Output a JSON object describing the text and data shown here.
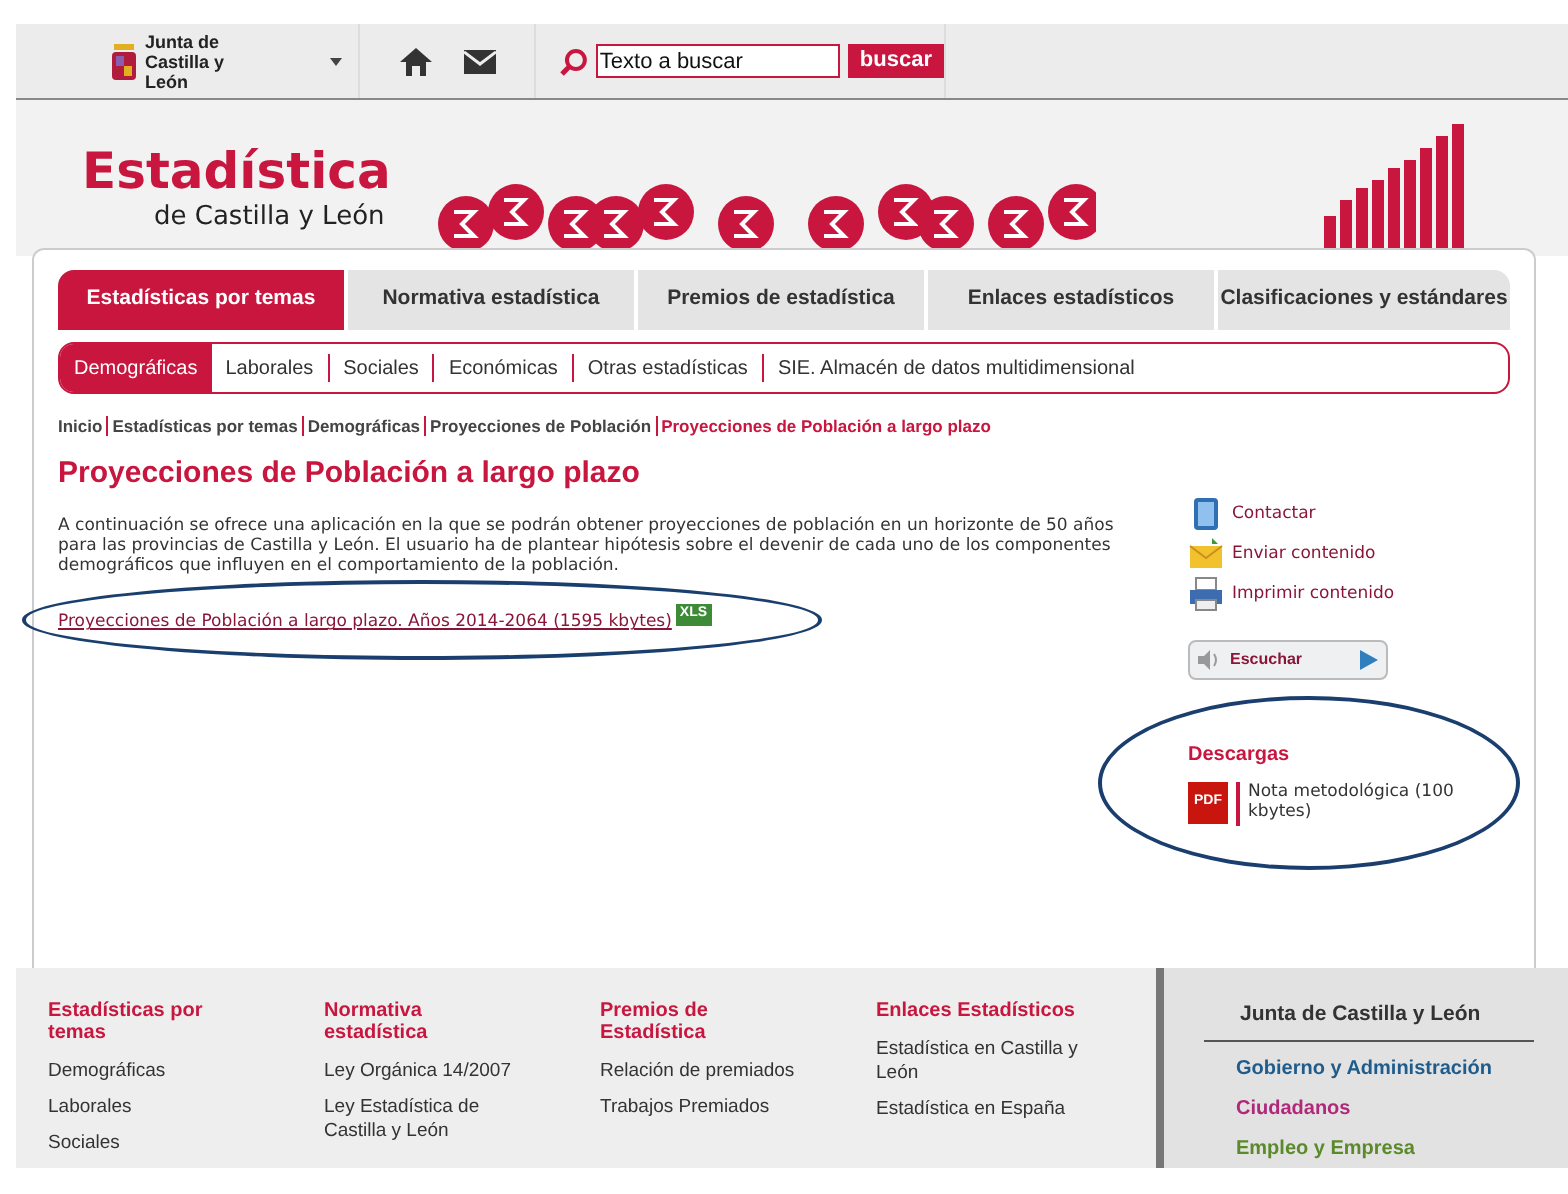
{
  "header": {
    "logo_text": "Junta de Castilla y León",
    "search": {
      "placeholder": "Texto a buscar"
    },
    "search_button": "buscar"
  },
  "banner": {
    "title": "Estadística",
    "subtitle": "de Castilla y León"
  },
  "tabs": [
    {
      "label": "Estadísticas por temas",
      "selected": true
    },
    {
      "label": "Normativa estadística",
      "selected": false
    },
    {
      "label": "Premios de estadística",
      "selected": false
    },
    {
      "label": "Enlaces estadísticos",
      "selected": false
    },
    {
      "label": "Clasificaciones y estándares",
      "selected": false
    }
  ],
  "subtabs": [
    {
      "label": "Demográficas",
      "selected": true
    },
    {
      "label": "Laborales",
      "selected": false
    },
    {
      "label": "Sociales",
      "selected": false
    },
    {
      "label": "Económicas",
      "selected": false
    },
    {
      "label": "Otras estadísticas",
      "selected": false
    },
    {
      "label": "SIE. Almacén de datos multidimensional",
      "selected": false
    }
  ],
  "breadcrumb": [
    {
      "label": "Inicio",
      "current": false
    },
    {
      "label": "Estadísticas por temas",
      "current": false
    },
    {
      "label": "Demográficas",
      "current": false
    },
    {
      "label": "Proyecciones de Población",
      "current": false
    },
    {
      "label": "Proyecciones de Población a largo plazo",
      "current": true
    }
  ],
  "page_title": "Proyecciones de Población a largo plazo",
  "intro": "A continuación se ofrece una aplicación en la que se podrán obtener proyecciones de población en un horizonte de 50 años para las provincias de Castilla y León. El usuario ha de plantear hipótesis sobre el devenir de cada uno de los componentes demográficos que influyen en el comportamiento de la población.",
  "download_link": {
    "label": "Proyecciones de Población a largo plazo. Años 2014-2064 (1595 kbytes)",
    "badge": "XLS"
  },
  "actions": [
    {
      "kind": "contact",
      "label": "Contactar"
    },
    {
      "kind": "send",
      "label": "Enviar contenido"
    },
    {
      "kind": "print",
      "label": "Imprimir contenido"
    }
  ],
  "listen_button": "Escuchar",
  "downloads": {
    "title": "Descargas",
    "items": [
      {
        "badge": "PDF",
        "label": "Nota metodológica (100 kbytes)"
      }
    ]
  },
  "footer": {
    "columns": [
      {
        "title": "Estadísticas por temas",
        "links": [
          "Demográficas",
          "Laborales",
          "Sociales"
        ]
      },
      {
        "title": "Normativa estadística",
        "links": [
          "Ley Orgánica 14/2007",
          "Ley Estadística de Castilla y León"
        ]
      },
      {
        "title": "Premios de Estadística",
        "links": [
          "Relación de premiados",
          "Trabajos Premiados"
        ]
      },
      {
        "title": "Enlaces Estadísticos",
        "links": [
          "Estadística en Castilla y León",
          "Estadística en España"
        ]
      }
    ],
    "side": {
      "title": "Junta de Castilla y León",
      "links": [
        {
          "label": "Gobierno y Administración",
          "color": "#1f5c8c"
        },
        {
          "label": "Ciudadanos",
          "color": "#b0287a"
        },
        {
          "label": "Empleo y Empresa",
          "color": "#5a8a2a"
        }
      ]
    }
  }
}
